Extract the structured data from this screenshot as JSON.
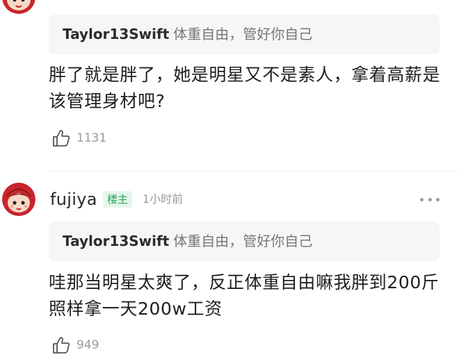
{
  "comments": [
    {
      "username": "",
      "quote": {
        "author": "Taylor13Swift",
        "text": "体重自由，管好你自己"
      },
      "text_lines": [
        "胖了就是胖了，她是明星又不是素人，拿着高薪是",
        "该管理身材吧?"
      ],
      "like_count": "1131",
      "like_icon": "thumbs-up-icon"
    },
    {
      "username": "fujiya",
      "badge": "楼主",
      "timestamp": "1小时前",
      "more_icon": "more-dots-icon",
      "avatar_icon": "avatar-cartoon-girl",
      "quote": {
        "author": "Taylor13Swift",
        "text": "体重自由，管好你自己"
      },
      "text_lines": [
        "哇那当明星太爽了，反正体重自由嘛我胖到200斤",
        "照样拿一天200w工资"
      ],
      "like_count": "949",
      "like_icon": "thumbs-up-icon"
    }
  ],
  "colors": {
    "badge_bg": "#e4f6ea",
    "badge_text": "#26a45a",
    "quote_bg": "#f6f6f6",
    "muted_text": "#9a9a9a"
  }
}
